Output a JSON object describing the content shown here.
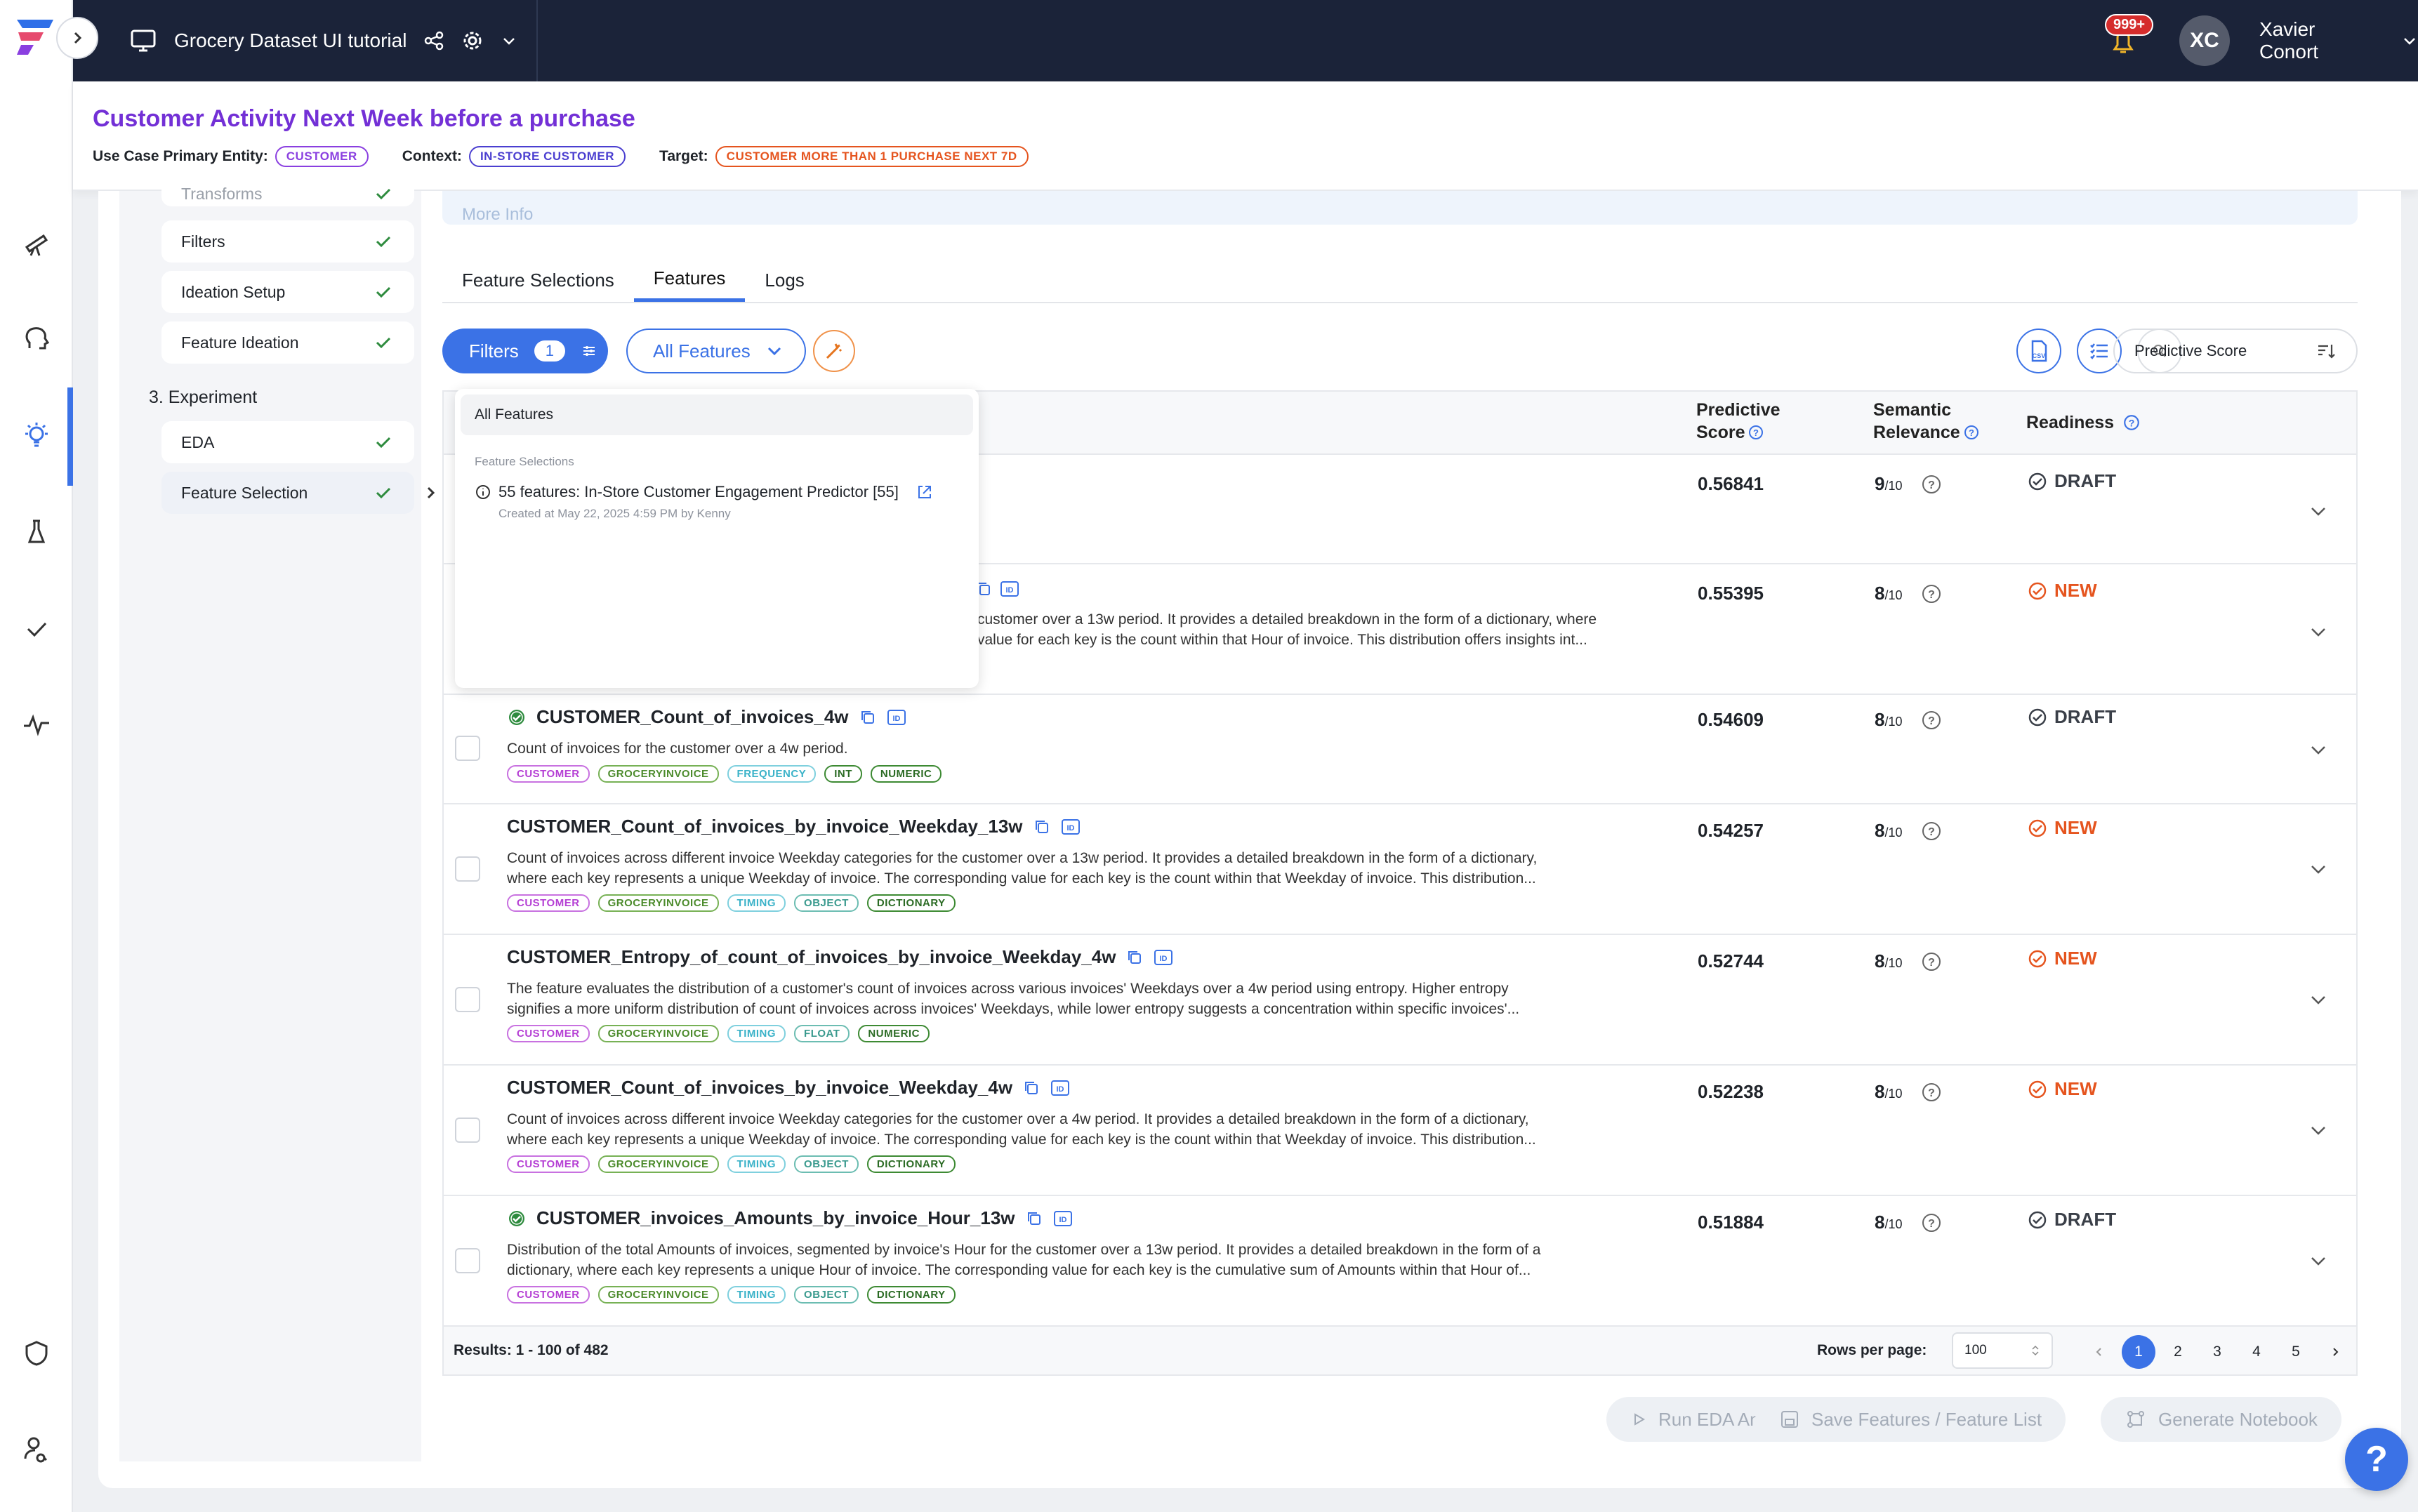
{
  "app": {
    "project_title": "Grocery Dataset UI tutorial",
    "notifications": "999+",
    "user_initials": "XC",
    "user_name": "Xavier Conort"
  },
  "use_case": {
    "title": "Customer Activity Next Week before a purchase",
    "entity_label": "Use Case Primary Entity:",
    "entity_value": "CUSTOMER",
    "context_label": "Context:",
    "context_value": "IN-STORE CUSTOMER",
    "target_label": "Target:",
    "target_value": "CUSTOMER MORE THAN 1 PURCHASE NEXT 7D"
  },
  "steps": {
    "transforms": "Transforms",
    "filters": "Filters",
    "ideation_setup": "Ideation Setup",
    "feature_ideation": "Feature Ideation",
    "section3": "3. Experiment",
    "eda": "EDA",
    "feature_selection": "Feature Selection"
  },
  "main": {
    "more_info": "More Info",
    "tabs": [
      "Feature Selections",
      "Features",
      "Logs"
    ],
    "filters_label": "Filters",
    "filters_count": "1",
    "all_features_label": "All Features",
    "sort_label": "Predictive Score"
  },
  "dropdown": {
    "all": "All Features",
    "section": "Feature Selections",
    "item": "55 features: In-Store Customer Engagement Predictor [55]",
    "item_meta": "Created at May 22, 2025 4:59 PM by Kenny"
  },
  "table": {
    "headers": {
      "predictive": "Predictive",
      "predictive2": "Score",
      "semantic": "Semantic",
      "semantic2": "Relevance",
      "readiness": "Readiness"
    },
    "rows": [
      {
        "name": "",
        "desc1": "",
        "desc2": "",
        "score": "0.56841",
        "sem": "9",
        "ready": "DRAFT"
      },
      {
        "name": "",
        "desc1": "customer over a 13w period. It provides a detailed breakdown in the form of a dictionary, where",
        "desc2": "value for each key is the count within that Hour of invoice. This distribution offers insights int...",
        "score": "0.55395",
        "sem": "8",
        "ready": "NEW"
      },
      {
        "name": "CUSTOMER_Count_of_invoices_4w",
        "desc1": "Count of invoices for the customer over a 4w period.",
        "desc2": "",
        "score": "0.54609",
        "sem": "8",
        "ready": "DRAFT",
        "tags": [
          "CUSTOMER",
          "GROCERYINVOICE",
          "FREQUENCY",
          "INT",
          "NUMERIC"
        ]
      },
      {
        "name": "CUSTOMER_Count_of_invoices_by_invoice_Weekday_13w",
        "desc1": "Count of invoices across different invoice Weekday categories for the customer over a 13w period. It provides a detailed breakdown in the form of a dictionary,",
        "desc2": "where each key represents a unique Weekday of invoice. The corresponding value for each key is the count within that Weekday of invoice. This distribution...",
        "score": "0.54257",
        "sem": "8",
        "ready": "NEW",
        "tags": [
          "CUSTOMER",
          "GROCERYINVOICE",
          "TIMING",
          "OBJECT",
          "DICTIONARY"
        ]
      },
      {
        "name": "CUSTOMER_Entropy_of_count_of_invoices_by_invoice_Weekday_4w",
        "desc1": "The feature evaluates the distribution of a customer's count of invoices across various invoices' Weekdays over a 4w period using entropy. Higher entropy",
        "desc2": "signifies a more uniform distribution of count of invoices across invoices' Weekdays, while lower entropy suggests a concentration within specific invoices'...",
        "score": "0.52744",
        "sem": "8",
        "ready": "NEW",
        "tags": [
          "CUSTOMER",
          "GROCERYINVOICE",
          "TIMING",
          "FLOAT",
          "NUMERIC"
        ]
      },
      {
        "name": "CUSTOMER_Count_of_invoices_by_invoice_Weekday_4w",
        "desc1": "Count of invoices across different invoice Weekday categories for the customer over a 4w period. It provides a detailed breakdown in the form of a dictionary,",
        "desc2": "where each key represents a unique Weekday of invoice. The corresponding value for each key is the count within that Weekday of invoice. This distribution...",
        "score": "0.52238",
        "sem": "8",
        "ready": "NEW",
        "tags": [
          "CUSTOMER",
          "GROCERYINVOICE",
          "TIMING",
          "OBJECT",
          "DICTIONARY"
        ]
      },
      {
        "name": "CUSTOMER_invoices_Amounts_by_invoice_Hour_13w",
        "desc1": "Distribution of the total Amounts of invoices, segmented by invoice's Hour for the customer over a 13w period. It provides a detailed breakdown in the form of a",
        "desc2": "dictionary, where each key represents a unique Hour of invoice. The corresponding value for each key is the cumulative sum of Amounts within that Hour of...",
        "score": "0.51884",
        "sem": "8",
        "ready": "DRAFT",
        "tags": [
          "CUSTOMER",
          "GROCERYINVOICE",
          "TIMING",
          "OBJECT",
          "DICTIONARY"
        ]
      }
    ],
    "sem_suffix": "/10"
  },
  "footer": {
    "results": "Results: 1 - 100 of 482",
    "rows_per_page_label": "Rows per page:",
    "rows_per_page": "100",
    "pages": [
      "1",
      "2",
      "3",
      "4",
      "5"
    ]
  },
  "actions": {
    "run_eda": "Run EDA Analysis",
    "save_features": "Save Features / Feature List",
    "generate_notebook": "Generate Notebook"
  },
  "help": "?",
  "colors": {
    "accent": "#3b72e6",
    "title_purple": "#7330d6",
    "new_orange": "#e5541e",
    "topbar": "#1b2339"
  }
}
